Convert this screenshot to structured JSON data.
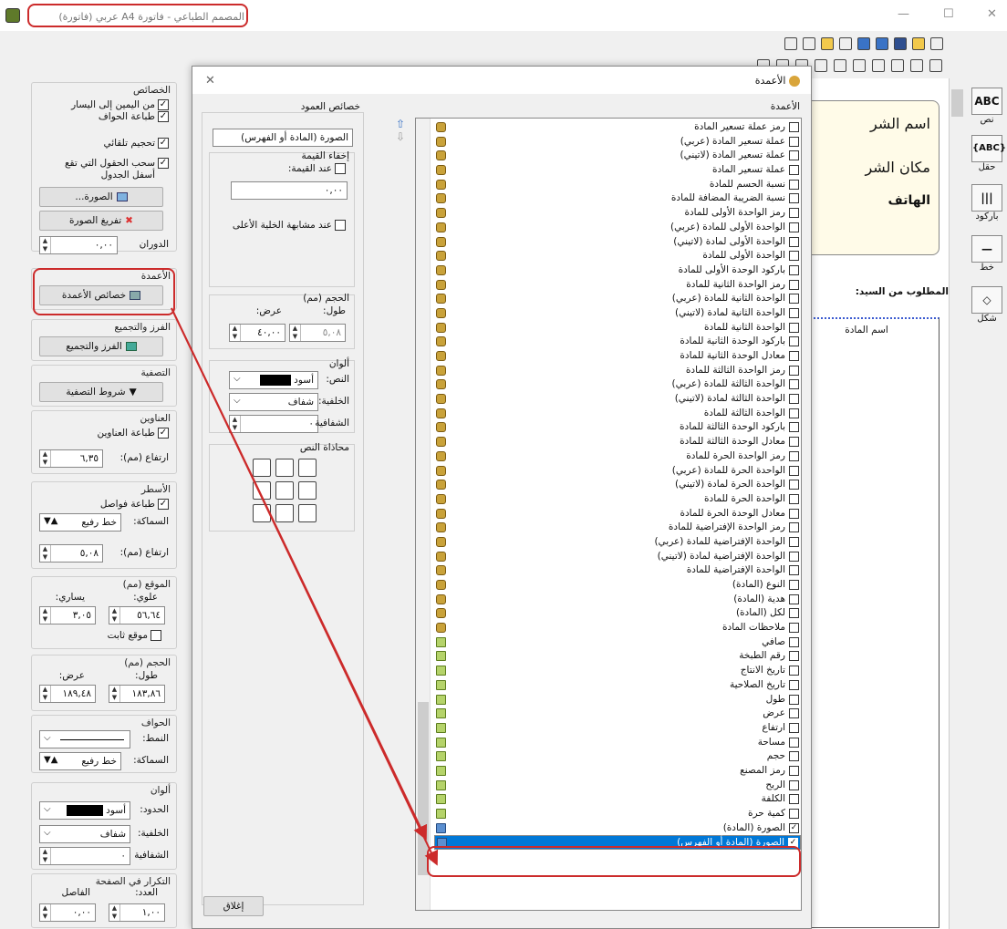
{
  "window": {
    "title": "المصمم الطباعي - فاتورة A4 عربي (فاتورة)",
    "minimize": "—",
    "maximize": "☐",
    "close": "✕"
  },
  "left_panel": {
    "properties": {
      "title": "الخصائص",
      "rtl": "من اليمين إلى اليسار",
      "print_borders": "طباعة الحواف",
      "auto_size": "تحجيم تلقائي",
      "pull_fields": "سحب الحقول التي تقع أسفل الجدول",
      "image_button": "الصورة...",
      "clear_image": "تفريغ الصورة",
      "rotation_label": "الدوران",
      "rotation_value": "٠,٠٠"
    },
    "columns": {
      "title": "الأعمدة",
      "button": "خصائص الأعمدة"
    },
    "sort": {
      "title": "الفرز والتجميع",
      "button": "الفرز والتجميع"
    },
    "filter": {
      "title": "التصفية",
      "button": "شروط التصفية"
    },
    "headers": {
      "title": "العناوين",
      "print": "طباعة العناوين",
      "height_label": "ارتفاع (مم):",
      "height_value": "٦,٣٥"
    },
    "lines": {
      "title": "الأسطر",
      "print_separators": "طباعة فواصل",
      "thickness_label": "السماكة:",
      "thickness_value": "خط رفيع",
      "height_label": "ارتفاع (مم):",
      "height_value": "٥,٠٨"
    },
    "position": {
      "title": "الموقع (مم)",
      "top_label": "علوي:",
      "left_label": "يساري:",
      "top_value": "٥٦,٦٤",
      "left_value": "٣,٠٥",
      "fixed": "موقع ثابت"
    },
    "size": {
      "title": "الحجم (مم)",
      "length_label": "طول:",
      "width_label": "عرض:",
      "length_value": "١٨٣,٨٦",
      "width_value": "١٨٩,٤٨"
    },
    "borders": {
      "title": "الحواف",
      "style_label": "النمط:",
      "thickness_label": "السماكة:",
      "thickness_value": "خط رفيع"
    },
    "colors": {
      "title": "ألوان",
      "border_label": "الحدود:",
      "border_value": "أسود",
      "bg_label": "الخلفية:",
      "bg_value": "شفاف",
      "transparency_label": "الشفافية"
    },
    "repeat": {
      "title": "التكرار في الصفحة",
      "count_label": "العدد:",
      "separator_label": "الفاصل",
      "count_value": "١,٠٠",
      "separator_value": "٠,٠٠"
    }
  },
  "canvas": {
    "company_name": "اسم الشر",
    "company_place": "مكان الشر",
    "phone": "الهاتف",
    "requested_from": "المطلوب من السيد:",
    "col_header": "اسم المادة"
  },
  "tools": [
    {
      "label": "نص",
      "icon": "ABC"
    },
    {
      "label": "حقل",
      "icon": "{ABC}"
    },
    {
      "label": "باركود",
      "icon": "|||"
    },
    {
      "label": "خط",
      "icon": "—"
    },
    {
      "label": "شكل",
      "icon": "◇"
    }
  ],
  "dialog": {
    "title": "الأعمدة",
    "close": "✕",
    "col_props": {
      "title": "خصائص العمود",
      "column_name": "الصورة (المادة أو الفهرس)",
      "hide_value": "إخفاء القيمة",
      "when_value": "عند القيمة:",
      "when_value_val": "٠,٠٠",
      "same_cell": "عند مشابهة الخلية الأعلى",
      "size_title": "الحجم (مم)",
      "length_label": "طول:",
      "width_label": "عرض:",
      "length_value": "٥,٠٨",
      "width_value": "٤٠,٠٠",
      "colors_title": "ألوان",
      "text_label": "النص:",
      "text_value": "أسود",
      "bg_label": "الخلفية:",
      "bg_value": "شفاف",
      "transparency_label": "الشفافية",
      "alignment_title": "محاذاة النص"
    },
    "list_title": "الأعمدة",
    "close_button": "إغلاق",
    "items": [
      {
        "label": "رمز عملة تسعير المادة",
        "checked": false,
        "icon": "db"
      },
      {
        "label": "عملة تسعير المادة (عربي)",
        "checked": false,
        "icon": "db"
      },
      {
        "label": "عملة تسعير المادة (لاتيني)",
        "checked": false,
        "icon": "db"
      },
      {
        "label": "عملة تسعير المادة",
        "checked": false,
        "icon": "db"
      },
      {
        "label": "نسبة الحسم للمادة",
        "checked": false,
        "icon": "db"
      },
      {
        "label": "نسبة الضريبة المضافة للمادة",
        "checked": false,
        "icon": "db"
      },
      {
        "label": "رمز الواحدة الأولى للمادة",
        "checked": false,
        "icon": "db"
      },
      {
        "label": "الواحدة الأولى للمادة (عربي)",
        "checked": false,
        "icon": "db"
      },
      {
        "label": "الواحدة الأولى لمادة (لاتيني)",
        "checked": false,
        "icon": "db"
      },
      {
        "label": "الواحدة الأولى للمادة",
        "checked": false,
        "icon": "db"
      },
      {
        "label": "باركود الوحدة الأولى للمادة",
        "checked": false,
        "icon": "db"
      },
      {
        "label": "رمز الواحدة الثانية للمادة",
        "checked": false,
        "icon": "db"
      },
      {
        "label": "الواحدة الثانية للمادة (عربي)",
        "checked": false,
        "icon": "db"
      },
      {
        "label": "الواحدة الثانية لمادة (لاتيني)",
        "checked": false,
        "icon": "db"
      },
      {
        "label": "الواحدة الثانية للمادة",
        "checked": false,
        "icon": "db"
      },
      {
        "label": "باركود الوحدة الثانية للمادة",
        "checked": false,
        "icon": "db"
      },
      {
        "label": "معادل الوحدة الثانية للمادة",
        "checked": false,
        "icon": "db"
      },
      {
        "label": "رمز الواحدة الثالثة للمادة",
        "checked": false,
        "icon": "db"
      },
      {
        "label": "الواحدة الثالثة للمادة (عربي)",
        "checked": false,
        "icon": "db"
      },
      {
        "label": "الواحدة الثالثة لمادة (لاتيني)",
        "checked": false,
        "icon": "db"
      },
      {
        "label": "الواحدة الثالثة للمادة",
        "checked": false,
        "icon": "db"
      },
      {
        "label": "باركود الوحدة الثالثة للمادة",
        "checked": false,
        "icon": "db"
      },
      {
        "label": "معادل الوحدة الثالثة للمادة",
        "checked": false,
        "icon": "db"
      },
      {
        "label": "رمز الواحدة الحرة للمادة",
        "checked": false,
        "icon": "db"
      },
      {
        "label": "الواحدة الحرة للمادة (عربي)",
        "checked": false,
        "icon": "db"
      },
      {
        "label": "الواحدة الحرة لمادة (لاتيني)",
        "checked": false,
        "icon": "db"
      },
      {
        "label": "الواحدة الحرة للمادة",
        "checked": false,
        "icon": "db"
      },
      {
        "label": "معادل الوحدة الحرة للمادة",
        "checked": false,
        "icon": "db"
      },
      {
        "label": "رمز الواحدة الإفتراضية للمادة",
        "checked": false,
        "icon": "db"
      },
      {
        "label": "الواحدة الإفتراضية للمادة (عربي)",
        "checked": false,
        "icon": "db"
      },
      {
        "label": "الواحدة الإفتراضية لمادة (لاتيني)",
        "checked": false,
        "icon": "db"
      },
      {
        "label": "الواحدة الإفتراضية للمادة",
        "checked": false,
        "icon": "db"
      },
      {
        "label": "النوع (المادة)",
        "checked": false,
        "icon": "db"
      },
      {
        "label": "هدية (المادة)",
        "checked": false,
        "icon": "db"
      },
      {
        "label": "لكل (المادة)",
        "checked": false,
        "icon": "db"
      },
      {
        "label": "ملاحظات المادة",
        "checked": false,
        "icon": "db"
      },
      {
        "label": "صافي",
        "checked": false,
        "icon": "pen"
      },
      {
        "label": "رقم الطبخة",
        "checked": false,
        "icon": "pen"
      },
      {
        "label": "تاريخ الانتاج",
        "checked": false,
        "icon": "pen"
      },
      {
        "label": "تاريخ الصلاحية",
        "checked": false,
        "icon": "pen"
      },
      {
        "label": "طول",
        "checked": false,
        "icon": "pen"
      },
      {
        "label": "عرض",
        "checked": false,
        "icon": "pen"
      },
      {
        "label": "ارتفاع",
        "checked": false,
        "icon": "pen"
      },
      {
        "label": "مساحة",
        "checked": false,
        "icon": "pen"
      },
      {
        "label": "حجم",
        "checked": false,
        "icon": "pen"
      },
      {
        "label": "رمز المصنع",
        "checked": false,
        "icon": "pen"
      },
      {
        "label": "الربح",
        "checked": false,
        "icon": "pen"
      },
      {
        "label": "الكلفة",
        "checked": false,
        "icon": "pen"
      },
      {
        "label": "كمية حرة",
        "checked": false,
        "icon": "pen"
      },
      {
        "label": "الصورة (المادة)",
        "checked": true,
        "icon": "img"
      },
      {
        "label": "الصورة (المادة أو الفهرس)",
        "checked": true,
        "icon": "img",
        "selected": true
      }
    ]
  },
  "colors": {
    "highlight": "#cc2b2b",
    "selection": "#0078d7"
  }
}
